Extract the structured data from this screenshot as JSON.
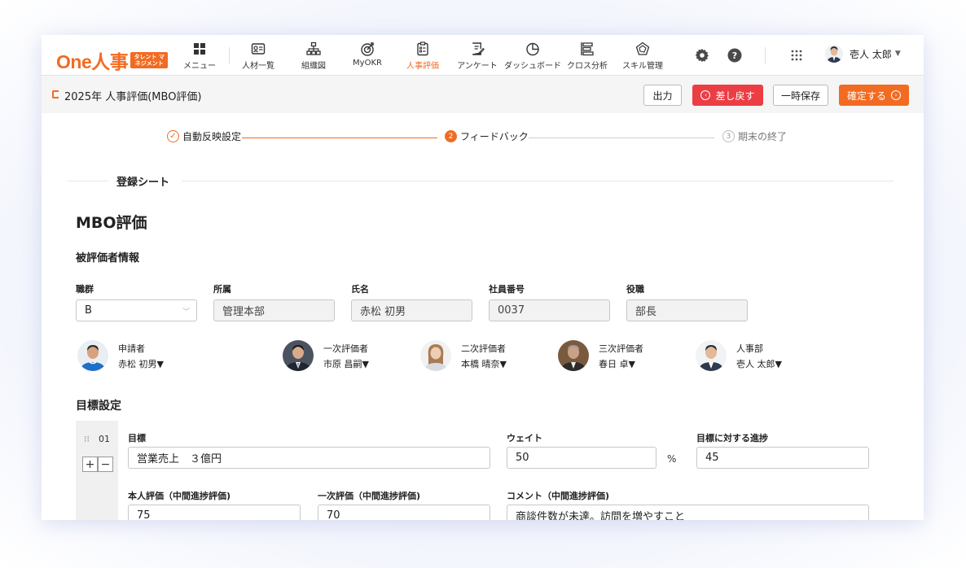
{
  "header": {
    "logo_text": "One人事",
    "logo_badge": "タレント マネジメント",
    "nav": [
      {
        "label": "メニュー",
        "icon": "grid-icon"
      },
      {
        "label": "人材一覧",
        "icon": "id-card-icon"
      },
      {
        "label": "組織図",
        "icon": "org-chart-icon"
      },
      {
        "label": "MyOKR",
        "icon": "target-icon"
      },
      {
        "label": "人事評価",
        "icon": "clipboard-icon",
        "active": true
      },
      {
        "label": "アンケート",
        "icon": "survey-icon"
      },
      {
        "label": "ダッシュボード",
        "icon": "pie-chart-icon"
      },
      {
        "label": "クロス分析",
        "icon": "cross-analysis-icon"
      },
      {
        "label": "スキル管理",
        "icon": "skill-radar-icon"
      }
    ],
    "user_name": "壱人 太郎"
  },
  "titlebar": {
    "title": "2025年 人事評価(MBO評価)",
    "output_label": "出力",
    "return_label": "差し戻す",
    "save_label": "一時保存",
    "confirm_label": "確定する"
  },
  "steps": [
    {
      "label": "自動反映設定",
      "state": "done"
    },
    {
      "num": "2",
      "label": "フィードバック",
      "state": "current"
    },
    {
      "num": "3",
      "label": "期末の終了",
      "state": "pending"
    }
  ],
  "section_label": "登録シート",
  "form": {
    "title": "MBO評価",
    "subject_heading": "被評価者情報",
    "fields": {
      "job_group": {
        "label": "職群",
        "value": "B"
      },
      "department": {
        "label": "所属",
        "value": "管理本部"
      },
      "name": {
        "label": "氏名",
        "value": "赤松 初男"
      },
      "employee_no": {
        "label": "社員番号",
        "value": "0037"
      },
      "position": {
        "label": "役職",
        "value": "部長"
      }
    },
    "evaluators": [
      {
        "role": "申請者",
        "name": "赤松 初男▼"
      },
      {
        "role": "一次評価者",
        "name": "市原 昌嗣▼"
      },
      {
        "role": "二次評価者",
        "name": "本橋 晴奈▼"
      },
      {
        "role": "三次評価者",
        "name": "春日 卓▼"
      },
      {
        "role": "人事部",
        "name": "壱人 太郎▼"
      }
    ],
    "goal_heading": "目標設定",
    "goal": {
      "number": "01",
      "goal_label": "目標",
      "goal_value": "営業売上　３億円",
      "weight_label": "ウェイト",
      "weight_value": "50",
      "weight_unit": "%",
      "progress_label": "目標に対する進捗",
      "progress_value": "45",
      "self_label": "本人評価（中間進捗評価)",
      "self_value": "75",
      "first_label": "一次評価（中間進捗評価)",
      "first_value": "70",
      "comment_label": "コメント（中間進捗評価)",
      "comment_value": "商談件数が未達。訪問を増やすこと"
    }
  },
  "colors": {
    "accent": "#f26b21",
    "danger": "#ec3d44"
  }
}
